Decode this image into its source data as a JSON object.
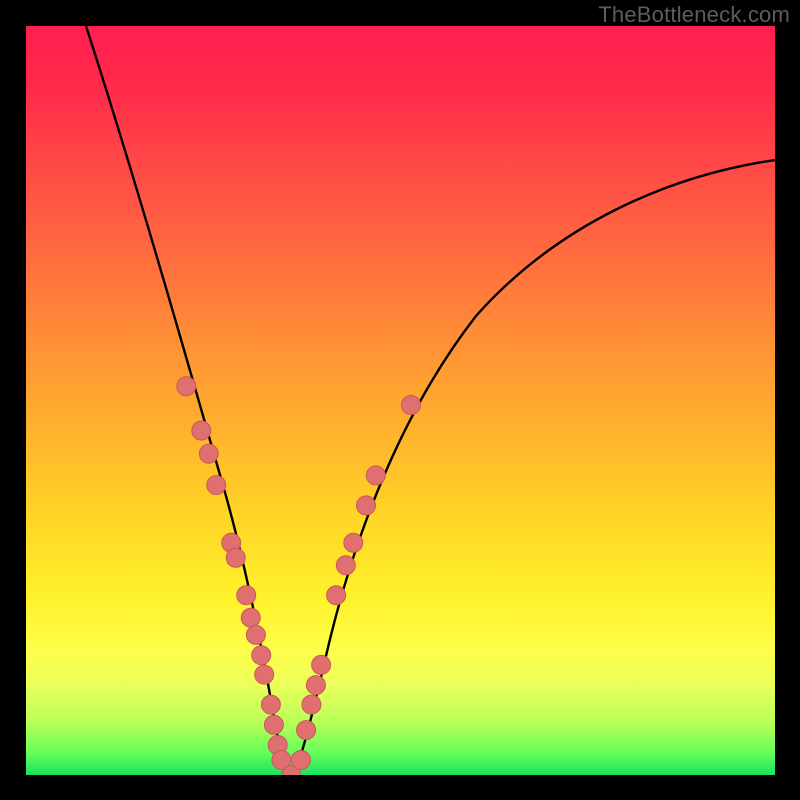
{
  "watermark": "TheBottleneck.com",
  "colors": {
    "page_bg": "#000000",
    "curve_stroke": "#000000",
    "marker_fill": "#e07070",
    "marker_stroke": "#c85858"
  },
  "chart_data": {
    "type": "line",
    "title": "",
    "xlabel": "",
    "ylabel": "",
    "xlim": [
      0,
      100
    ],
    "ylim": [
      0,
      100
    ],
    "note": "No axes, ticks, or labels are rendered in the image; values are estimated from curve geometry relative to the 749×749 plot frame. y is drawn inverted (0 at top).",
    "series": [
      {
        "name": "curve",
        "x": [
          8.0,
          10.5,
          13.1,
          15.7,
          18.0,
          20.4,
          22.7,
          24.3,
          25.6,
          27.2,
          28.4,
          29.5,
          30.4,
          31.2,
          32.2,
          33.4,
          34.8,
          36.0,
          37.4,
          38.6,
          40.1,
          42.7,
          45.4,
          49.4,
          53.4,
          58.7,
          64.1,
          70.8,
          77.4,
          85.4,
          93.5,
          100.0
        ],
        "y": [
          100.0,
          91.3,
          82.0,
          72.6,
          64.6,
          56.6,
          48.6,
          42.9,
          38.2,
          32.6,
          28.0,
          24.0,
          20.4,
          16.6,
          11.5,
          5.6,
          0.0,
          0.0,
          5.6,
          11.5,
          18.6,
          28.0,
          36.0,
          45.5,
          52.1,
          58.9,
          64.2,
          69.6,
          73.7,
          77.4,
          80.4,
          82.1
        ]
      }
    ],
    "markers": [
      {
        "x": 21.4,
        "y": 51.9
      },
      {
        "x": 23.4,
        "y": 46.0
      },
      {
        "x": 24.4,
        "y": 42.9
      },
      {
        "x": 25.4,
        "y": 38.7
      },
      {
        "x": 27.4,
        "y": 31.0
      },
      {
        "x": 28.0,
        "y": 29.0
      },
      {
        "x": 29.4,
        "y": 24.0
      },
      {
        "x": 30.0,
        "y": 21.0
      },
      {
        "x": 30.7,
        "y": 18.7
      },
      {
        "x": 31.4,
        "y": 16.0
      },
      {
        "x": 31.8,
        "y": 13.4
      },
      {
        "x": 32.7,
        "y": 9.4
      },
      {
        "x": 33.1,
        "y": 6.7
      },
      {
        "x": 33.6,
        "y": 4.0
      },
      {
        "x": 34.1,
        "y": 2.0
      },
      {
        "x": 35.4,
        "y": 0.0
      },
      {
        "x": 36.7,
        "y": 2.0
      },
      {
        "x": 37.4,
        "y": 6.0
      },
      {
        "x": 38.1,
        "y": 9.4
      },
      {
        "x": 38.7,
        "y": 12.0
      },
      {
        "x": 39.4,
        "y": 14.7
      },
      {
        "x": 41.4,
        "y": 24.0
      },
      {
        "x": 42.7,
        "y": 28.0
      },
      {
        "x": 43.7,
        "y": 31.0
      },
      {
        "x": 45.4,
        "y": 36.0
      },
      {
        "x": 46.7,
        "y": 40.0
      },
      {
        "x": 51.4,
        "y": 49.4
      }
    ]
  }
}
